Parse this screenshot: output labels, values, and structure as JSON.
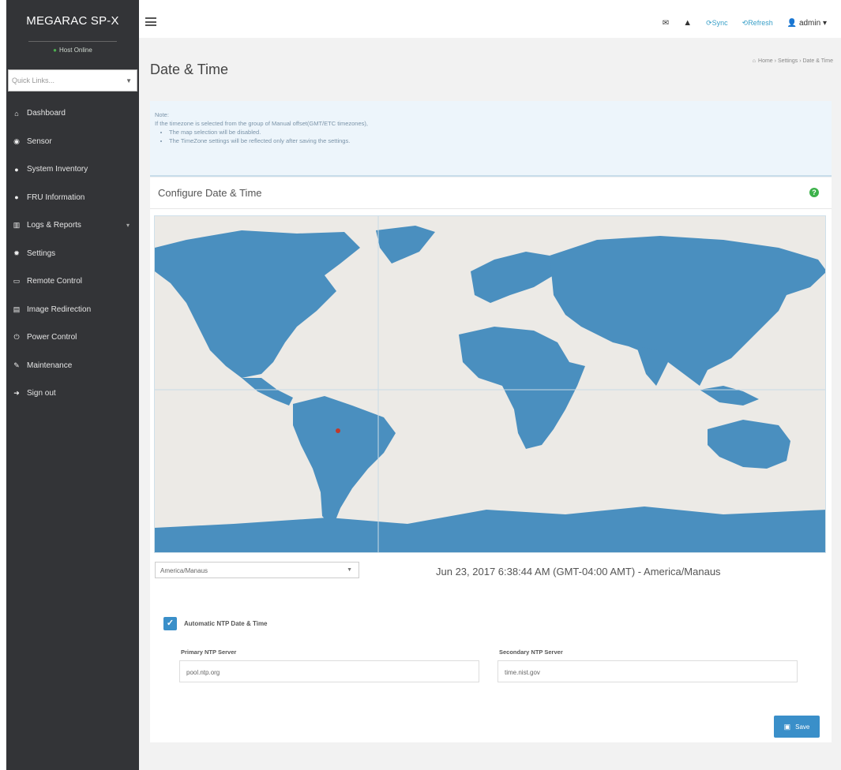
{
  "sidebar": {
    "brand": "MEGARAC SP-X",
    "status": "Host Online",
    "quick_links_placeholder": "Quick Links...",
    "items": [
      {
        "label": "Dashboard",
        "icon": "dashboard-icon"
      },
      {
        "label": "Sensor",
        "icon": "sensor-icon"
      },
      {
        "label": "System Inventory",
        "icon": "info-icon"
      },
      {
        "label": "FRU Information",
        "icon": "info-icon"
      },
      {
        "label": "Logs & Reports",
        "icon": "chart-icon"
      },
      {
        "label": "Settings",
        "icon": "gear-icon"
      },
      {
        "label": "Remote Control",
        "icon": "monitor-icon"
      },
      {
        "label": "Image Redirection",
        "icon": "disk-icon"
      },
      {
        "label": "Power Control",
        "icon": "power-icon"
      },
      {
        "label": "Maintenance",
        "icon": "wrench-icon"
      },
      {
        "label": "Sign out",
        "icon": "signout-icon"
      }
    ]
  },
  "topbar": {
    "sync": "Sync",
    "refresh": "Refresh",
    "user": "admin"
  },
  "page": {
    "title": "Date & Time",
    "breadcrumb": [
      "Home",
      "Settings",
      "Date & Time"
    ]
  },
  "note": {
    "heading": "Note:",
    "text": "If the timezone is selected from the group of Manual offset(GMT/ETC timezones),",
    "bullets": [
      "The map selection will be disabled.",
      "The TimeZone settings will be reflected only after saving the settings."
    ]
  },
  "panel": {
    "title": "Configure Date & Time",
    "timezone_value": "America/Manaus",
    "datetime_readout": "Jun 23, 2017 6:38:44 AM (GMT-04:00 AMT)  -  America/Manaus",
    "ntp_label": "Automatic NTP Date & Time",
    "primary_label": "Primary NTP Server",
    "primary_value": "pool.ntp.org",
    "secondary_label": "Secondary NTP Server",
    "secondary_value": "time.nist.gov",
    "save_label": "Save"
  },
  "colors": {
    "sidebar_bg": "#333437",
    "accent": "#3a8fc9",
    "map_land": "#4a8fbf",
    "map_ocean": "#eceae6"
  }
}
